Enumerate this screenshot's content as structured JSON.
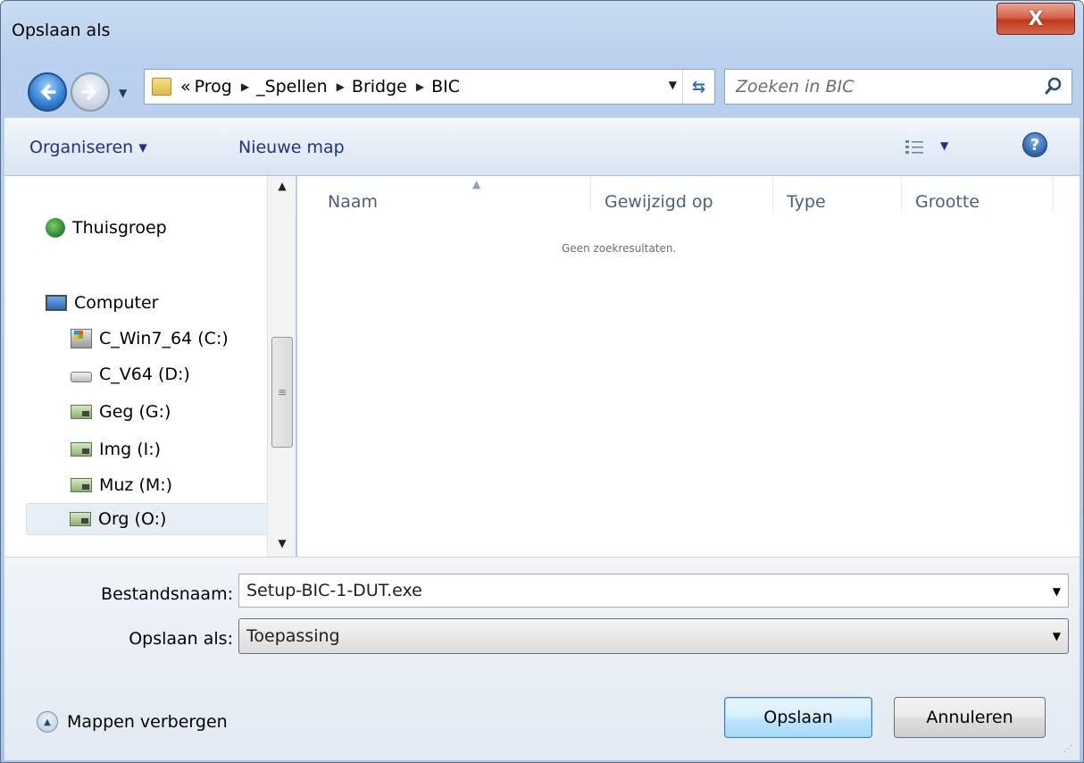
{
  "window": {
    "title": "Opslaan als",
    "close_label": "X"
  },
  "address": {
    "overflow": "«",
    "crumbs": [
      "Prog",
      "_Spellen",
      "Bridge",
      "BIC"
    ]
  },
  "search": {
    "placeholder": "Zoeken in BIC"
  },
  "toolbar": {
    "organize_label": "Organiseren ▾",
    "new_folder_label": "Nieuwe map",
    "help_label": "?"
  },
  "nav": {
    "items": [
      {
        "label": "Thuisgroep",
        "icon": "homegroup-icon"
      },
      {
        "label": "Computer",
        "icon": "computer-icon"
      },
      {
        "label": "C_Win7_64 (C:)",
        "icon": "windows-drive-icon"
      },
      {
        "label": "C_V64 (D:)",
        "icon": "hard-drive-icon"
      },
      {
        "label": "Geg (G:)",
        "icon": "network-drive-icon"
      },
      {
        "label": "Img (I:)",
        "icon": "network-drive-icon"
      },
      {
        "label": "Muz (M:)",
        "icon": "network-drive-icon"
      },
      {
        "label": "Org (O:)",
        "icon": "network-drive-icon"
      }
    ],
    "selected_index": 7
  },
  "filelist": {
    "columns": [
      "Naam",
      "Gewijzigd op",
      "Type",
      "Grootte"
    ],
    "empty_message": "Geen zoekresultaten."
  },
  "form": {
    "filename_label": "Bestandsnaam:",
    "filename_value": "Setup-BIC-1-DUT.exe",
    "savetype_label": "Opslaan als:",
    "savetype_value": "Toepassing"
  },
  "footer": {
    "toggle_label": "Mappen verbergen",
    "save_label": "Opslaan",
    "cancel_label": "Annuleren"
  },
  "colors": {
    "accent": "#1e3287",
    "save_button_border": "#3c7fb1",
    "close_button": "#c2391d"
  }
}
